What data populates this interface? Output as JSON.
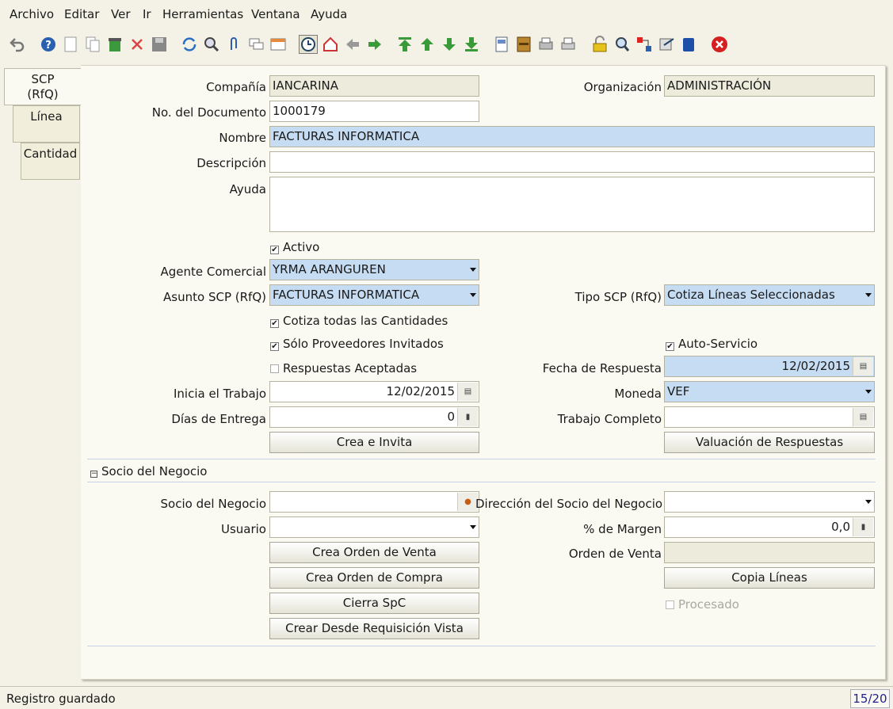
{
  "menu": [
    "Archivo",
    "Editar",
    "Ver",
    "Ir",
    "Herramientas",
    "Ventana",
    "Ayuda"
  ],
  "tabs": [
    "SCP (RfQ)",
    "Línea",
    "Cantidad"
  ],
  "tabs_lines": {
    "scp_1": "SCP",
    "scp_2": "(RfQ)"
  },
  "form": {
    "company_label": "Compañía",
    "company_value": "IANCARINA",
    "org_label": "Organización",
    "org_value": "ADMINISTRACIÓN",
    "docno_label": "No. del Documento",
    "docno_value": "1000179",
    "name_label": "Nombre",
    "name_value": "FACTURAS INFORMATICA",
    "desc_label": "Descripción",
    "desc_value": "",
    "help_label": "Ayuda",
    "help_value": "",
    "active_label": "Activo",
    "salesrep_label": "Agente Comercial",
    "salesrep_value": "YRMA ARANGUREN",
    "topic_label": "Asunto SCP (RfQ)",
    "topic_value": "FACTURAS INFORMATICA",
    "type_label": "Tipo SCP (RfQ)",
    "type_value": "Cotiza Líneas Seleccionadas",
    "quoteall_label": "Cotiza todas las Cantidades",
    "invited_label": "Sólo Proveedores Invitados",
    "selfservice_label": "Auto-Servicio",
    "accepted_label": "Respuestas Aceptadas",
    "responsedate_label": "Fecha de Respuesta",
    "responsedate_value": "12/02/2015",
    "workstart_label": "Inicia el Trabajo",
    "workstart_value": "12/02/2015",
    "currency_label": "Moneda",
    "currency_value": "VEF",
    "deliverydays_label": "Días de Entrega",
    "deliverydays_value": "0",
    "workcomplete_label": "Trabajo Completo",
    "workcomplete_value": "",
    "createinvite_button": "Crea e Invita",
    "rank_button": "Valuación de Respuestas"
  },
  "section": {
    "title": "Socio del Negocio",
    "toggle": "−",
    "bpartner_label": "Socio del Negocio",
    "bpartner_value": "",
    "bplocation_label": "Dirección del Socio del Negocio",
    "bplocation_value": "",
    "user_label": "Usuario",
    "user_value": "",
    "margin_label": "% de Margen",
    "margin_value": "0,0",
    "createso_button": "Crea Orden de Venta",
    "salesorder_label": "Orden de Venta",
    "salesorder_value": "",
    "createpo_button": "Crea Orden de Compra",
    "copylines_button": "Copia Líneas",
    "close_button": "Cierra SpC",
    "processed_label": "Procesado",
    "fromreq_button": "Crear Desde Requisición Vista"
  },
  "status": {
    "message": "Registro guardado",
    "count": "15/20"
  },
  "colors": {
    "required": "#c6dcf2",
    "readonly": "#ecebdc",
    "background": "#f4f2e6"
  }
}
